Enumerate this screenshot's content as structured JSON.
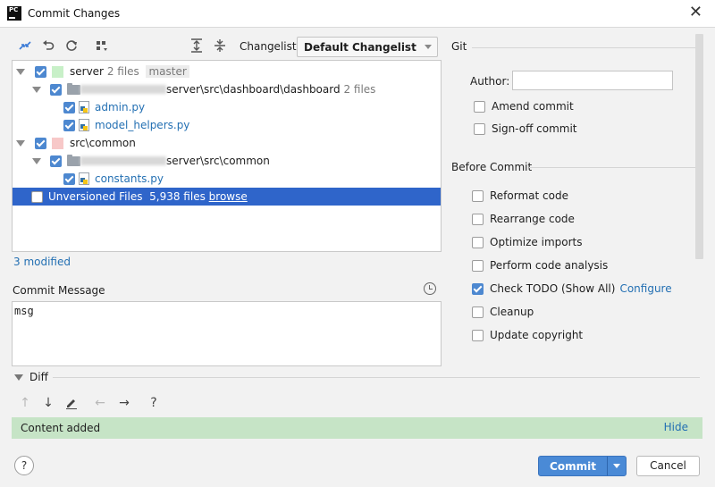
{
  "window": {
    "title": "Commit Changes",
    "app_icon_text": "PC"
  },
  "toolbar": {
    "changelist_label": "Changelist:",
    "changelist_value": "Default Changelist"
  },
  "tree": {
    "rows": [
      {
        "name": "server",
        "count": "2 files",
        "branch": "master",
        "color": "#c8f0c8"
      },
      {
        "path_suffix": "server\\src\\dashboard\\dashboard",
        "count": "2 files"
      },
      {
        "name": "admin.py"
      },
      {
        "name": "model_helpers.py"
      },
      {
        "name": "src\\common",
        "color": "#f7c8c8"
      },
      {
        "path_suffix": "server\\src\\common"
      },
      {
        "name": "constants.py"
      },
      {
        "name": "Unversioned Files",
        "count": "5,938 files",
        "link": "browse"
      }
    ]
  },
  "modified_text": "3 modified",
  "commit_message": {
    "label": "Commit Message",
    "value": "msg"
  },
  "diff": {
    "label": "Diff",
    "status_text": "Content added",
    "hide_label": "Hide",
    "icons": [
      "up-arrow",
      "down-arrow",
      "edit",
      "left-arrow",
      "right-arrow",
      "help"
    ]
  },
  "git_section": {
    "label": "Git",
    "author_label": "Author:",
    "author_value": "",
    "amend_label": "Amend commit",
    "signoff_label": "Sign-off commit"
  },
  "before_commit": {
    "label": "Before Commit",
    "options": [
      {
        "label": "Reformat code",
        "checked": false
      },
      {
        "label": "Rearrange code",
        "checked": false
      },
      {
        "label": "Optimize imports",
        "checked": false
      },
      {
        "label": "Perform code analysis",
        "checked": false
      },
      {
        "label": "Check TODO (Show All)",
        "checked": true,
        "extra": "Configure"
      },
      {
        "label": "Cleanup",
        "checked": false
      },
      {
        "label": "Update copyright",
        "checked": false
      }
    ]
  },
  "buttons": {
    "help": "?",
    "commit": "Commit",
    "cancel": "Cancel"
  },
  "colors": {
    "accent": "#2f65ca",
    "button_primary": "#4a8ad6",
    "link": "#2470b3",
    "added_bg": "#c6e4c6"
  }
}
